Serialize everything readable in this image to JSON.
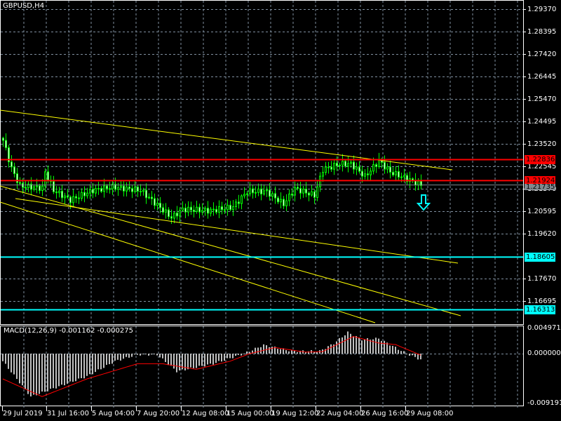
{
  "window": {
    "title": "GBPUSD,H4"
  },
  "colors": {
    "bull": "#00ff00",
    "bear_body": "#ffffff",
    "grid": "#8090a0",
    "support": "#ff0000",
    "target": "#00ffff",
    "trend": "#ffff00",
    "bid": "#808890",
    "macd_hist": "#c0c0c0",
    "macd_signal": "#ff0000"
  },
  "price_axis": {
    "ticks": [
      "1.29370",
      "1.28395",
      "1.27420",
      "1.26445",
      "1.25470",
      "1.24495",
      "1.23520",
      "1.22545",
      "1.21570",
      "1.20595",
      "1.19620",
      "1.17670",
      "1.16695"
    ]
  },
  "levels": [
    {
      "price": 1.22836,
      "label": "1.22836",
      "kind": "support"
    },
    {
      "price": 1.21924,
      "label": "1.21924",
      "kind": "support"
    },
    {
      "price": 1.18605,
      "label": "1.18605",
      "kind": "target"
    },
    {
      "price": 1.16313,
      "label": "1.16313",
      "kind": "target"
    }
  ],
  "bid": {
    "price": 1.21735,
    "label": "1.21735"
  },
  "time_axis": [
    "29 Jul 2019",
    "31 Jul 16:00",
    "5 Aug 04:00",
    "7 Aug 20:00",
    "12 Aug 08:00",
    "15 Aug 00:00",
    "19 Aug 12:00",
    "22 Aug 04:00",
    "26 Aug 16:00",
    "29 Aug 08:00"
  ],
  "macd": {
    "title": "MACD(12,26,9) -0.001162 -0.000275",
    "ticks": [
      "0.004971",
      "0.000000",
      "-0.009191"
    ]
  },
  "chart_data": {
    "type": "candlestick",
    "symbol": "GBPUSD",
    "timeframe": "H4",
    "ylim": [
      1.154,
      1.2978
    ],
    "bars": 150,
    "close_keypoints": [
      [
        0,
        1.2367
      ],
      [
        3,
        1.2245
      ],
      [
        6,
        1.2169
      ],
      [
        14,
        1.216
      ],
      [
        15,
        1.223
      ],
      [
        18,
        1.215
      ],
      [
        24,
        1.2108
      ],
      [
        32,
        1.215
      ],
      [
        39,
        1.2165
      ],
      [
        49,
        1.215
      ],
      [
        56,
        1.2075
      ],
      [
        60,
        1.2032
      ],
      [
        64,
        1.2068
      ],
      [
        74,
        1.2062
      ],
      [
        82,
        1.2078
      ],
      [
        87,
        1.2145
      ],
      [
        94,
        1.2145
      ],
      [
        100,
        1.209
      ],
      [
        104,
        1.2158
      ],
      [
        111,
        1.2128
      ],
      [
        114,
        1.224
      ],
      [
        120,
        1.2265
      ],
      [
        124,
        1.2265
      ],
      [
        129,
        1.221
      ],
      [
        134,
        1.2278
      ],
      [
        138,
        1.223
      ],
      [
        143,
        1.2205
      ],
      [
        149,
        1.2174
      ]
    ],
    "trendlines": [
      {
        "from": [
          -0.75,
          1.24982
        ],
        "to": [
          160.5,
          1.22392
        ]
      },
      {
        "from": [
          -0.75,
          1.21692
        ],
        "to": [
          163.5,
          1.16055
        ]
      },
      {
        "from": [
          4.75,
          1.21143
        ],
        "to": [
          162.5,
          1.1834
        ]
      },
      {
        "from": [
          -0.75,
          1.20991
        ],
        "to": [
          133,
          1.1575
        ]
      }
    ],
    "signal_arrow": {
      "bar": 150,
      "price": 1.2093,
      "direction": "down"
    },
    "macd": {
      "ylim": [
        -0.0093,
        0.0052
      ],
      "hist_keypoints": [
        [
          0,
          -0.0015
        ],
        [
          10,
          -0.0085
        ],
        [
          30,
          -0.0045
        ],
        [
          40,
          -0.0015
        ],
        [
          48,
          -0.0002
        ],
        [
          55,
          -0.0002
        ],
        [
          62,
          -0.0035
        ],
        [
          75,
          -0.002
        ],
        [
          86,
          0.0
        ],
        [
          93,
          0.0017
        ],
        [
          103,
          0.0005
        ],
        [
          113,
          0.0005
        ],
        [
          118,
          0.002
        ],
        [
          123,
          0.0042
        ],
        [
          128,
          0.0028
        ],
        [
          134,
          0.003
        ],
        [
          140,
          0.0012
        ],
        [
          144,
          0.0
        ],
        [
          149,
          -0.0012
        ]
      ],
      "signal_keypoints": [
        [
          0,
          -0.005
        ],
        [
          14,
          -0.0085
        ],
        [
          30,
          -0.005
        ],
        [
          48,
          -0.002
        ],
        [
          57,
          -0.002
        ],
        [
          69,
          -0.0031
        ],
        [
          81,
          -0.0015
        ],
        [
          88,
          0.0
        ],
        [
          97,
          0.0012
        ],
        [
          108,
          0.0003
        ],
        [
          114,
          0.0004
        ],
        [
          125,
          0.0034
        ],
        [
          134,
          0.0021
        ],
        [
          140,
          0.0018
        ],
        [
          149,
          -0.0003
        ]
      ]
    }
  }
}
